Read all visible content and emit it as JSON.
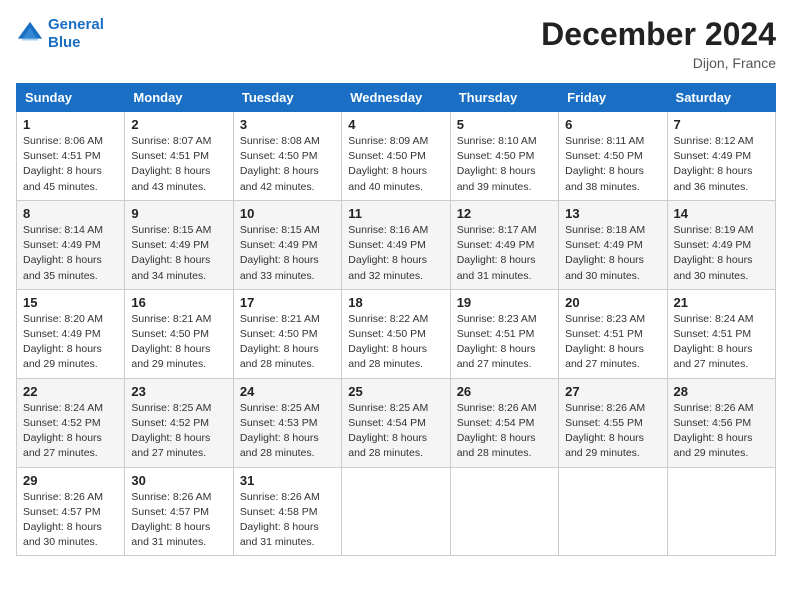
{
  "header": {
    "logo_line1": "General",
    "logo_line2": "Blue",
    "month_year": "December 2024",
    "location": "Dijon, France"
  },
  "weekdays": [
    "Sunday",
    "Monday",
    "Tuesday",
    "Wednesday",
    "Thursday",
    "Friday",
    "Saturday"
  ],
  "weeks": [
    [
      {
        "day": "1",
        "info": "Sunrise: 8:06 AM\nSunset: 4:51 PM\nDaylight: 8 hours\nand 45 minutes."
      },
      {
        "day": "2",
        "info": "Sunrise: 8:07 AM\nSunset: 4:51 PM\nDaylight: 8 hours\nand 43 minutes."
      },
      {
        "day": "3",
        "info": "Sunrise: 8:08 AM\nSunset: 4:50 PM\nDaylight: 8 hours\nand 42 minutes."
      },
      {
        "day": "4",
        "info": "Sunrise: 8:09 AM\nSunset: 4:50 PM\nDaylight: 8 hours\nand 40 minutes."
      },
      {
        "day": "5",
        "info": "Sunrise: 8:10 AM\nSunset: 4:50 PM\nDaylight: 8 hours\nand 39 minutes."
      },
      {
        "day": "6",
        "info": "Sunrise: 8:11 AM\nSunset: 4:50 PM\nDaylight: 8 hours\nand 38 minutes."
      },
      {
        "day": "7",
        "info": "Sunrise: 8:12 AM\nSunset: 4:49 PM\nDaylight: 8 hours\nand 36 minutes."
      }
    ],
    [
      {
        "day": "8",
        "info": "Sunrise: 8:14 AM\nSunset: 4:49 PM\nDaylight: 8 hours\nand 35 minutes."
      },
      {
        "day": "9",
        "info": "Sunrise: 8:15 AM\nSunset: 4:49 PM\nDaylight: 8 hours\nand 34 minutes."
      },
      {
        "day": "10",
        "info": "Sunrise: 8:15 AM\nSunset: 4:49 PM\nDaylight: 8 hours\nand 33 minutes."
      },
      {
        "day": "11",
        "info": "Sunrise: 8:16 AM\nSunset: 4:49 PM\nDaylight: 8 hours\nand 32 minutes."
      },
      {
        "day": "12",
        "info": "Sunrise: 8:17 AM\nSunset: 4:49 PM\nDaylight: 8 hours\nand 31 minutes."
      },
      {
        "day": "13",
        "info": "Sunrise: 8:18 AM\nSunset: 4:49 PM\nDaylight: 8 hours\nand 30 minutes."
      },
      {
        "day": "14",
        "info": "Sunrise: 8:19 AM\nSunset: 4:49 PM\nDaylight: 8 hours\nand 30 minutes."
      }
    ],
    [
      {
        "day": "15",
        "info": "Sunrise: 8:20 AM\nSunset: 4:49 PM\nDaylight: 8 hours\nand 29 minutes."
      },
      {
        "day": "16",
        "info": "Sunrise: 8:21 AM\nSunset: 4:50 PM\nDaylight: 8 hours\nand 29 minutes."
      },
      {
        "day": "17",
        "info": "Sunrise: 8:21 AM\nSunset: 4:50 PM\nDaylight: 8 hours\nand 28 minutes."
      },
      {
        "day": "18",
        "info": "Sunrise: 8:22 AM\nSunset: 4:50 PM\nDaylight: 8 hours\nand 28 minutes."
      },
      {
        "day": "19",
        "info": "Sunrise: 8:23 AM\nSunset: 4:51 PM\nDaylight: 8 hours\nand 27 minutes."
      },
      {
        "day": "20",
        "info": "Sunrise: 8:23 AM\nSunset: 4:51 PM\nDaylight: 8 hours\nand 27 minutes."
      },
      {
        "day": "21",
        "info": "Sunrise: 8:24 AM\nSunset: 4:51 PM\nDaylight: 8 hours\nand 27 minutes."
      }
    ],
    [
      {
        "day": "22",
        "info": "Sunrise: 8:24 AM\nSunset: 4:52 PM\nDaylight: 8 hours\nand 27 minutes."
      },
      {
        "day": "23",
        "info": "Sunrise: 8:25 AM\nSunset: 4:52 PM\nDaylight: 8 hours\nand 27 minutes."
      },
      {
        "day": "24",
        "info": "Sunrise: 8:25 AM\nSunset: 4:53 PM\nDaylight: 8 hours\nand 28 minutes."
      },
      {
        "day": "25",
        "info": "Sunrise: 8:25 AM\nSunset: 4:54 PM\nDaylight: 8 hours\nand 28 minutes."
      },
      {
        "day": "26",
        "info": "Sunrise: 8:26 AM\nSunset: 4:54 PM\nDaylight: 8 hours\nand 28 minutes."
      },
      {
        "day": "27",
        "info": "Sunrise: 8:26 AM\nSunset: 4:55 PM\nDaylight: 8 hours\nand 29 minutes."
      },
      {
        "day": "28",
        "info": "Sunrise: 8:26 AM\nSunset: 4:56 PM\nDaylight: 8 hours\nand 29 minutes."
      }
    ],
    [
      {
        "day": "29",
        "info": "Sunrise: 8:26 AM\nSunset: 4:57 PM\nDaylight: 8 hours\nand 30 minutes."
      },
      {
        "day": "30",
        "info": "Sunrise: 8:26 AM\nSunset: 4:57 PM\nDaylight: 8 hours\nand 31 minutes."
      },
      {
        "day": "31",
        "info": "Sunrise: 8:26 AM\nSunset: 4:58 PM\nDaylight: 8 hours\nand 31 minutes."
      },
      {
        "day": "",
        "info": ""
      },
      {
        "day": "",
        "info": ""
      },
      {
        "day": "",
        "info": ""
      },
      {
        "day": "",
        "info": ""
      }
    ]
  ]
}
